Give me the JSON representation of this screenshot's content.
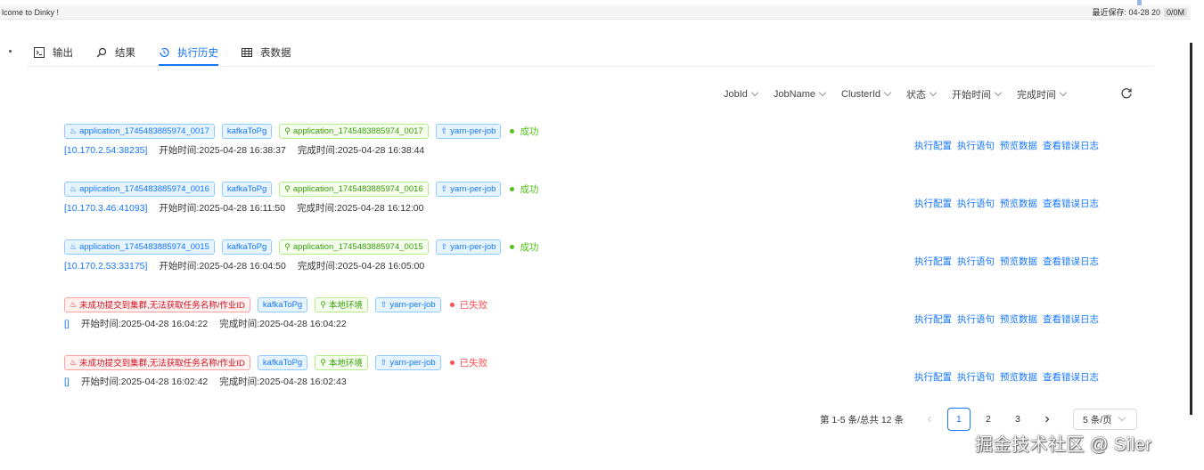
{
  "statusbar": {
    "welcome": "lcome to Dinky !",
    "last_saved": "最近保存: 04-28 20",
    "memory": "0/0M"
  },
  "tabs": [
    {
      "label": "输出",
      "icon": "terminal-icon",
      "active": false
    },
    {
      "label": "结果",
      "icon": "search-icon",
      "active": false
    },
    {
      "label": "执行历史",
      "icon": "history-icon",
      "active": true
    },
    {
      "label": "表数据",
      "icon": "table-icon",
      "active": false
    }
  ],
  "filters": [
    "JobId",
    "JobName",
    "ClusterId",
    "状态",
    "开始时间",
    "完成时间"
  ],
  "actions": [
    "执行配置",
    "执行语句",
    "预览数据",
    "查看错误日志"
  ],
  "records": [
    {
      "app": "application_1745483885974_0017",
      "job": "kafkaToPg",
      "cluster": "application_1745483885974_0017",
      "type": "yarn-per-job",
      "status": "成功",
      "addr": "[10.170.2.54:38235]",
      "start": "开始时间:2025-04-28 16:38:37",
      "end": "完成时间:2025-04-28 16:38:44"
    },
    {
      "app": "application_1745483885974_0016",
      "job": "kafkaToPg",
      "cluster": "application_1745483885974_0016",
      "type": "yarn-per-job",
      "status": "成功",
      "addr": "[10.170.3.46:41093]",
      "start": "开始时间:2025-04-28 16:11:50",
      "end": "完成时间:2025-04-28 16:12:00"
    },
    {
      "app": "application_1745483885974_0015",
      "job": "kafkaToPg",
      "cluster": "application_1745483885974_0015",
      "type": "yarn-per-job",
      "status": "成功",
      "addr": "[10.170.2.53:33175]",
      "start": "开始时间:2025-04-28 16:04:50",
      "end": "完成时间:2025-04-28 16:05:00"
    },
    {
      "app": "未成功提交到集群,无法获取任务名称/作业ID",
      "job": "kafkaToPg",
      "cluster": "本地环境",
      "type": "yarn-per-job",
      "status": "已失败",
      "addr": "[]",
      "start": "开始时间:2025-04-28 16:04:22",
      "end": "完成时间:2025-04-28 16:04:22"
    },
    {
      "app": "未成功提交到集群,无法获取任务名称/作业ID",
      "job": "kafkaToPg",
      "cluster": "本地环境",
      "type": "yarn-per-job",
      "status": "已失败",
      "addr": "[]",
      "start": "开始时间:2025-04-28 16:02:42",
      "end": "完成时间:2025-04-28 16:02:43"
    }
  ],
  "pagination": {
    "total": "第 1-5 条/总共 12 条",
    "pages": [
      "1",
      "2",
      "3"
    ],
    "current": "1",
    "page_size": "5 条/页"
  },
  "watermark": "掘金技术社区 @ Siler",
  "colors": {
    "accent": "#1677ff",
    "success": "#52c41a",
    "error": "#ff4d4f"
  }
}
